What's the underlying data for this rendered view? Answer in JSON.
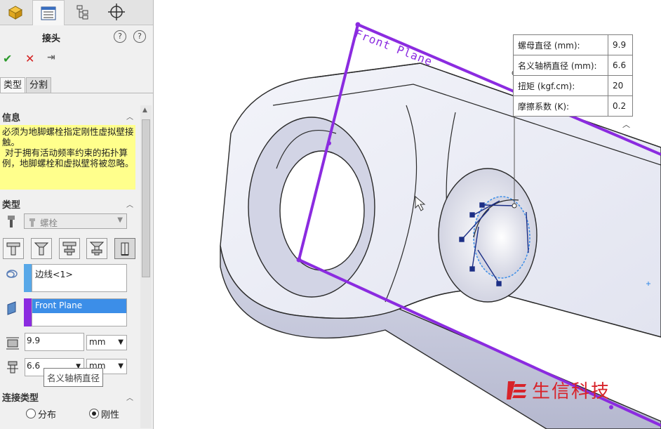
{
  "panel": {
    "title": "接头",
    "subtabs": [
      "类型",
      "分割"
    ],
    "info": {
      "header": "信息",
      "text": "必须为地脚螺栓指定刚性虚拟壁接触。\n 对于拥有活动频率约束的拓扑算例，地脚螺栓和虚拟壁将被忽略。"
    },
    "type_section": {
      "header": "类型",
      "selected": "螺栓"
    },
    "edge_selection": "边线<1>",
    "plane_selection": "Front Plane",
    "nut_diameter": {
      "value": "9.9",
      "unit": "mm"
    },
    "shank_diameter": {
      "value": "6.6",
      "unit": "mm"
    },
    "tooltip": "名义轴柄直径",
    "connection": {
      "header": "连接类型",
      "options": [
        "分布",
        "刚性"
      ],
      "selected": "刚性"
    }
  },
  "viewport": {
    "plane_label": "Front Plane",
    "props": [
      {
        "label": "螺母直径 (mm):",
        "value": "9.9"
      },
      {
        "label": "名义轴柄直径 (mm):",
        "value": "6.6"
      },
      {
        "label": "扭矩 (kgf.cm):",
        "value": "20"
      },
      {
        "label": "摩擦系数 (K):",
        "value": "0.2"
      }
    ],
    "watermark": "生信科技"
  },
  "colors": {
    "plane": "#8b2be0",
    "info_bg": "#ffff8c",
    "selection_blue": "#3c8ee8",
    "watermark": "#d8232a"
  },
  "icons": [
    "part-icon",
    "property-manager-icon",
    "configuration-icon",
    "crosshair-icon",
    "help-icon",
    "pin-icon",
    "check-icon",
    "close-icon",
    "bolt-icon",
    "edge-icon",
    "plane-icon",
    "nut-diameter-icon",
    "shank-diameter-icon"
  ]
}
